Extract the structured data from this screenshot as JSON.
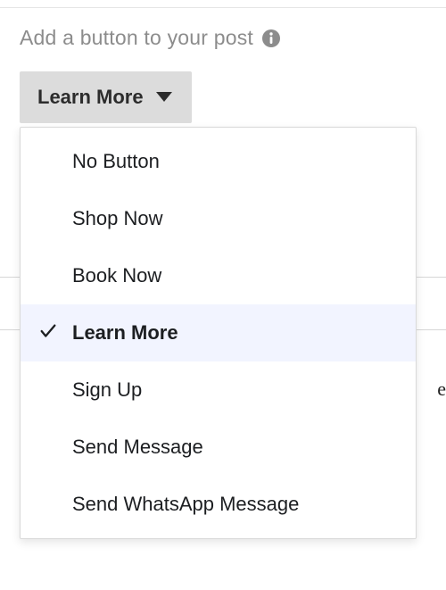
{
  "section": {
    "title": "Add a button to your post"
  },
  "dropdown": {
    "selected_label": "Learn More",
    "options": [
      {
        "label": "No Button",
        "selected": false
      },
      {
        "label": "Shop Now",
        "selected": false
      },
      {
        "label": "Book Now",
        "selected": false
      },
      {
        "label": "Learn More",
        "selected": true
      },
      {
        "label": "Sign Up",
        "selected": false
      },
      {
        "label": "Send Message",
        "selected": false
      },
      {
        "label": "Send WhatsApp Message",
        "selected": false
      }
    ]
  },
  "icons": {
    "info": "info-circle-icon",
    "caret": "caret-down-icon",
    "check": "check-icon"
  },
  "colors": {
    "text_muted": "#8c8c8c",
    "button_bg": "#dcdcdc",
    "selected_bg": "#f2f4ff",
    "border": "#d9d9d9"
  }
}
